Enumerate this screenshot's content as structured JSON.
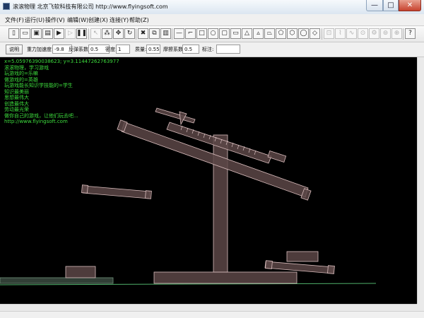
{
  "window": {
    "title": "滚滚物理 北京飞软科技有限公司 http://www.flyingsoft.com",
    "min_glyph": "—",
    "max_glyph": "□",
    "close_glyph": "✕"
  },
  "menu": [
    {
      "label": "文件(F)"
    },
    {
      "label": "运行(U)"
    },
    {
      "label": "操作(V)"
    },
    {
      "label": "编辑(W)"
    },
    {
      "label": "创建(X)"
    },
    {
      "label": "连接(Y)"
    },
    {
      "label": "帮助(Z)"
    }
  ],
  "toolbar": {
    "buttons": [
      {
        "icon": "new-file-icon",
        "glyph": "▯"
      },
      {
        "icon": "open-file-icon",
        "glyph": "▭"
      },
      {
        "icon": "save-icon",
        "glyph": "▣"
      },
      {
        "icon": "save-as-icon",
        "glyph": "▤"
      },
      {
        "icon": "run-icon",
        "glyph": "▶"
      },
      {
        "icon": "play-disabled-icon",
        "glyph": "▷"
      },
      {
        "icon": "pause-icon",
        "glyph": "❚❚"
      },
      {
        "icon": "select-pointer-icon",
        "glyph": "↖"
      },
      {
        "icon": "multi-select-icon",
        "glyph": "⁂"
      },
      {
        "icon": "move-icon",
        "glyph": "✥"
      },
      {
        "icon": "rotate-icon",
        "glyph": "↻"
      },
      {
        "icon": "delete-icon",
        "glyph": "✖"
      },
      {
        "icon": "copy-icon",
        "glyph": "⧉"
      },
      {
        "icon": "paste-icon",
        "glyph": "▥"
      },
      {
        "icon": "line-icon",
        "glyph": "—"
      },
      {
        "icon": "angle-line-icon",
        "glyph": "⌐"
      },
      {
        "icon": "rectangle-icon",
        "glyph": "□"
      },
      {
        "icon": "circle-icon",
        "glyph": "○"
      },
      {
        "icon": "square-icon",
        "glyph": "▢"
      },
      {
        "icon": "wide-rectangle-icon",
        "glyph": "▭"
      },
      {
        "icon": "triangle-icon",
        "glyph": "△"
      },
      {
        "icon": "triangle-outline-icon",
        "glyph": "▵"
      },
      {
        "icon": "trapezoid-icon",
        "glyph": "⏢"
      },
      {
        "icon": "pentagon-icon",
        "glyph": "⬠"
      },
      {
        "icon": "hexagon-icon",
        "glyph": "⬡"
      },
      {
        "icon": "ellipse-icon",
        "glyph": "◯"
      },
      {
        "icon": "polygon-icon",
        "glyph": "◇"
      },
      {
        "icon": "hinge-joint-icon",
        "glyph": "⊡"
      },
      {
        "icon": "spring-joint-icon",
        "glyph": "⌇"
      },
      {
        "icon": "rope-joint-icon",
        "glyph": "∿"
      },
      {
        "icon": "pivot-joint-icon",
        "glyph": "⊙"
      },
      {
        "icon": "gear-joint-icon",
        "glyph": "⚙"
      },
      {
        "icon": "motor-joint-icon",
        "glyph": "⊚"
      },
      {
        "icon": "pulley-joint-icon",
        "glyph": "⊕"
      },
      {
        "icon": "help-icon",
        "glyph": "?"
      }
    ]
  },
  "props": {
    "describe_button": "说明",
    "gravity_label": "重力加速度:",
    "gravity_value": "-9.8",
    "restitution_label": "反弹系数:",
    "restitution_value": "0.5",
    "density_label": "密度:",
    "density_value": "1",
    "mass_label": "质量:",
    "mass_value": "0.55",
    "friction_label": "摩擦系数:",
    "friction_value": "0.5",
    "tag_label": "标注:",
    "tag_value": ""
  },
  "hud": {
    "coords": "x=5.05976390038623; y=3.11447262763977",
    "lines": [
      "滚滚物理，学习游戏",
      "玩游戏的=乐嘛",
      "做游戏的=英雄",
      "玩游戏能长知识学技能的=学生",
      "知识最美丽",
      "思想最伟大",
      "创造最伟大",
      "劳动最光荣",
      "做你自己的游戏，让他们玩去吧...",
      "http://www.flyingsoft.com"
    ]
  },
  "colors": {
    "canvas_bg": "#000000",
    "body_fill": "#5c4646",
    "body_stroke": "#d9bdbd",
    "ground_line": "#4fb06a",
    "hud_text": "#3ddc3d",
    "close_btn": "#c7422e"
  }
}
